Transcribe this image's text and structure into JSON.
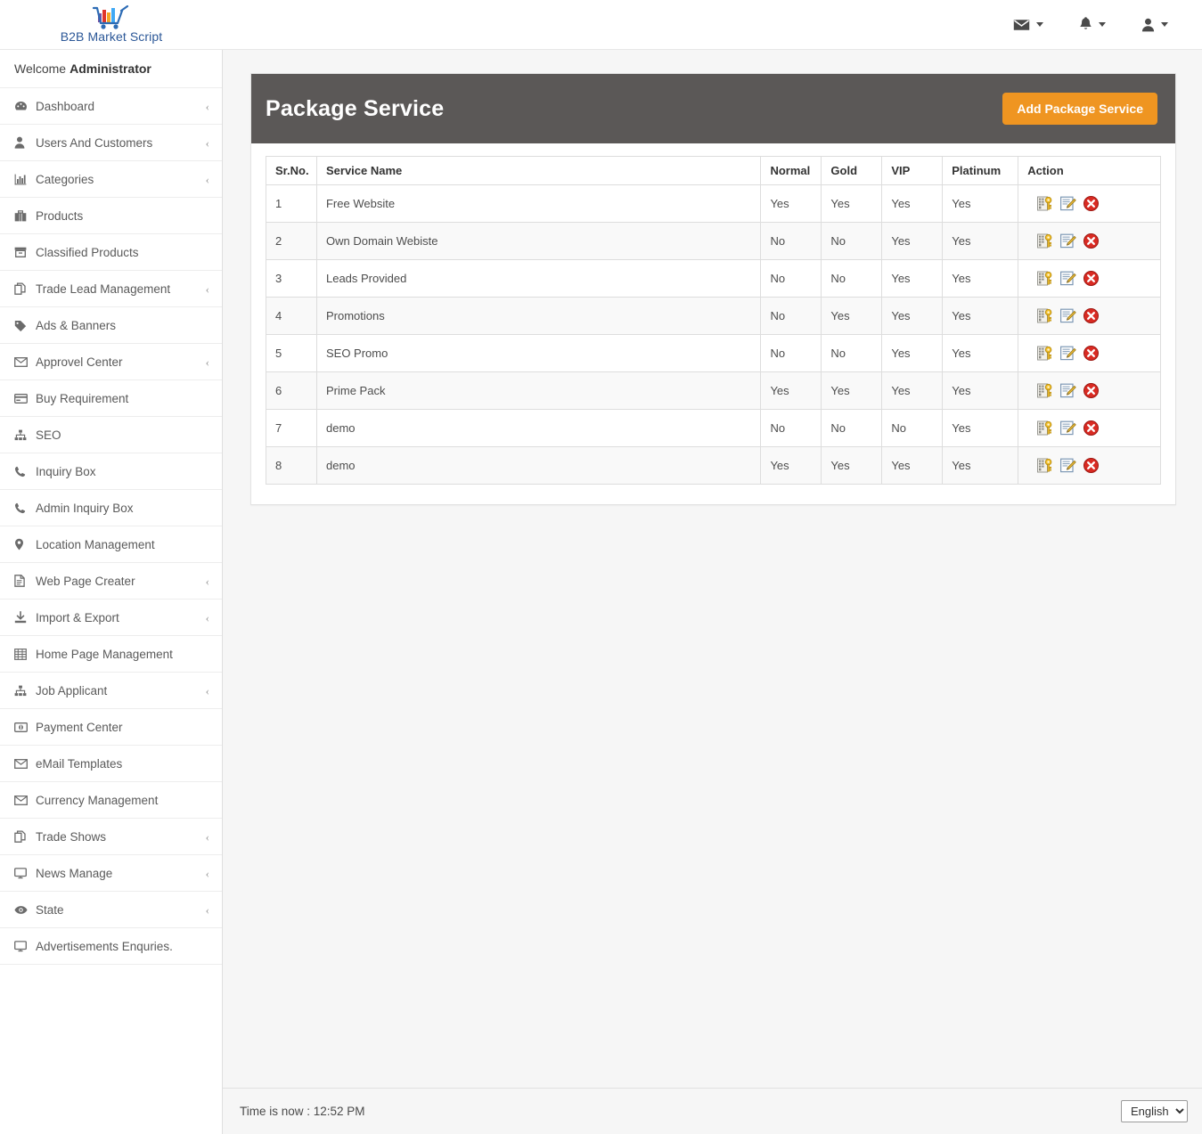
{
  "brand": {
    "name": "B2B Market Script",
    "logo_icon": "shopping-cart-bar-chart-icon",
    "colors": {
      "text": "#2b5797",
      "bar1": "#7b4fa0",
      "bar2": "#e0342b",
      "bar3": "#f5a623",
      "bar4": "#3fa9f5",
      "bar5": "#2d6cb5"
    }
  },
  "topnav": {
    "items": [
      {
        "icon": "envelope-icon",
        "name": "messages-menu"
      },
      {
        "icon": "bell-icon",
        "name": "notifications-menu"
      },
      {
        "icon": "user-icon",
        "name": "account-menu"
      }
    ]
  },
  "sidebar": {
    "welcome_prefix": "Welcome",
    "welcome_user": "Administrator",
    "items": [
      {
        "label": "Dashboard",
        "icon": "dashboard-icon",
        "expandable": true
      },
      {
        "label": "Users And Customers",
        "icon": "user-icon",
        "expandable": true
      },
      {
        "label": "Categories",
        "icon": "bar-chart-icon",
        "expandable": true
      },
      {
        "label": "Products",
        "icon": "briefcase-icon",
        "expandable": false
      },
      {
        "label": "Classified Products",
        "icon": "archive-icon",
        "expandable": false
      },
      {
        "label": "Trade Lead Management",
        "icon": "copy-icon",
        "expandable": true
      },
      {
        "label": "Ads & Banners",
        "icon": "tag-icon",
        "expandable": false
      },
      {
        "label": "Approvel Center",
        "icon": "envelope-icon",
        "expandable": true
      },
      {
        "label": "Buy Requirement",
        "icon": "credit-card-icon",
        "expandable": false
      },
      {
        "label": "SEO",
        "icon": "sitemap-icon",
        "expandable": false
      },
      {
        "label": "Inquiry Box",
        "icon": "phone-icon",
        "expandable": false
      },
      {
        "label": "Admin Inquiry Box",
        "icon": "phone-icon",
        "expandable": false
      },
      {
        "label": "Location Management",
        "icon": "map-marker-icon",
        "expandable": false
      },
      {
        "label": "Web Page Creater",
        "icon": "file-text-icon",
        "expandable": true
      },
      {
        "label": "Import & Export",
        "icon": "download-icon",
        "expandable": true
      },
      {
        "label": "Home Page Management",
        "icon": "table-icon",
        "expandable": false
      },
      {
        "label": "Job Applicant",
        "icon": "sitemap-icon",
        "expandable": true
      },
      {
        "label": "Payment Center",
        "icon": "money-icon",
        "expandable": false
      },
      {
        "label": "eMail Templates",
        "icon": "envelope-icon",
        "expandable": false
      },
      {
        "label": "Currency Management",
        "icon": "envelope-icon",
        "expandable": false
      },
      {
        "label": "Trade Shows",
        "icon": "copy-icon",
        "expandable": true
      },
      {
        "label": "News Manage",
        "icon": "desktop-icon",
        "expandable": true
      },
      {
        "label": "State",
        "icon": "eye-icon",
        "expandable": true
      },
      {
        "label": "Advertisements Enquries.",
        "icon": "desktop-icon",
        "expandable": false
      }
    ],
    "expand_glyph": "‹"
  },
  "page": {
    "title": "Package Service",
    "add_button": "Add Package Service",
    "accent_color": "#ef9521",
    "header_bg": "#5b5857"
  },
  "table": {
    "columns": [
      "Sr.No.",
      "Service Name",
      "Normal",
      "Gold",
      "VIP",
      "Platinum",
      "Action"
    ],
    "rows": [
      {
        "sr": "1",
        "service": "Free Website",
        "normal": "Yes",
        "gold": "Yes",
        "vip": "Yes",
        "platinum": "Yes"
      },
      {
        "sr": "2",
        "service": "Own Domain Webiste",
        "normal": "No",
        "gold": "No",
        "vip": "Yes",
        "platinum": "Yes"
      },
      {
        "sr": "3",
        "service": "Leads Provided",
        "normal": "No",
        "gold": "No",
        "vip": "Yes",
        "platinum": "Yes"
      },
      {
        "sr": "4",
        "service": "Promotions",
        "normal": "No",
        "gold": "Yes",
        "vip": "Yes",
        "platinum": "Yes"
      },
      {
        "sr": "5",
        "service": "SEO Promo",
        "normal": "No",
        "gold": "No",
        "vip": "Yes",
        "platinum": "Yes"
      },
      {
        "sr": "6",
        "service": "Prime Pack",
        "normal": "Yes",
        "gold": "Yes",
        "vip": "Yes",
        "platinum": "Yes"
      },
      {
        "sr": "7",
        "service": "demo",
        "normal": "No",
        "gold": "No",
        "vip": "No",
        "platinum": "Yes"
      },
      {
        "sr": "8",
        "service": "demo",
        "normal": "Yes",
        "gold": "Yes",
        "vip": "Yes",
        "platinum": "Yes"
      }
    ],
    "action_icons": [
      "permissions-key-icon",
      "edit-pencil-icon",
      "delete-icon"
    ]
  },
  "footer": {
    "time_text": "Time is now : 12:52 PM",
    "language": "English",
    "language_options": [
      "English"
    ]
  }
}
